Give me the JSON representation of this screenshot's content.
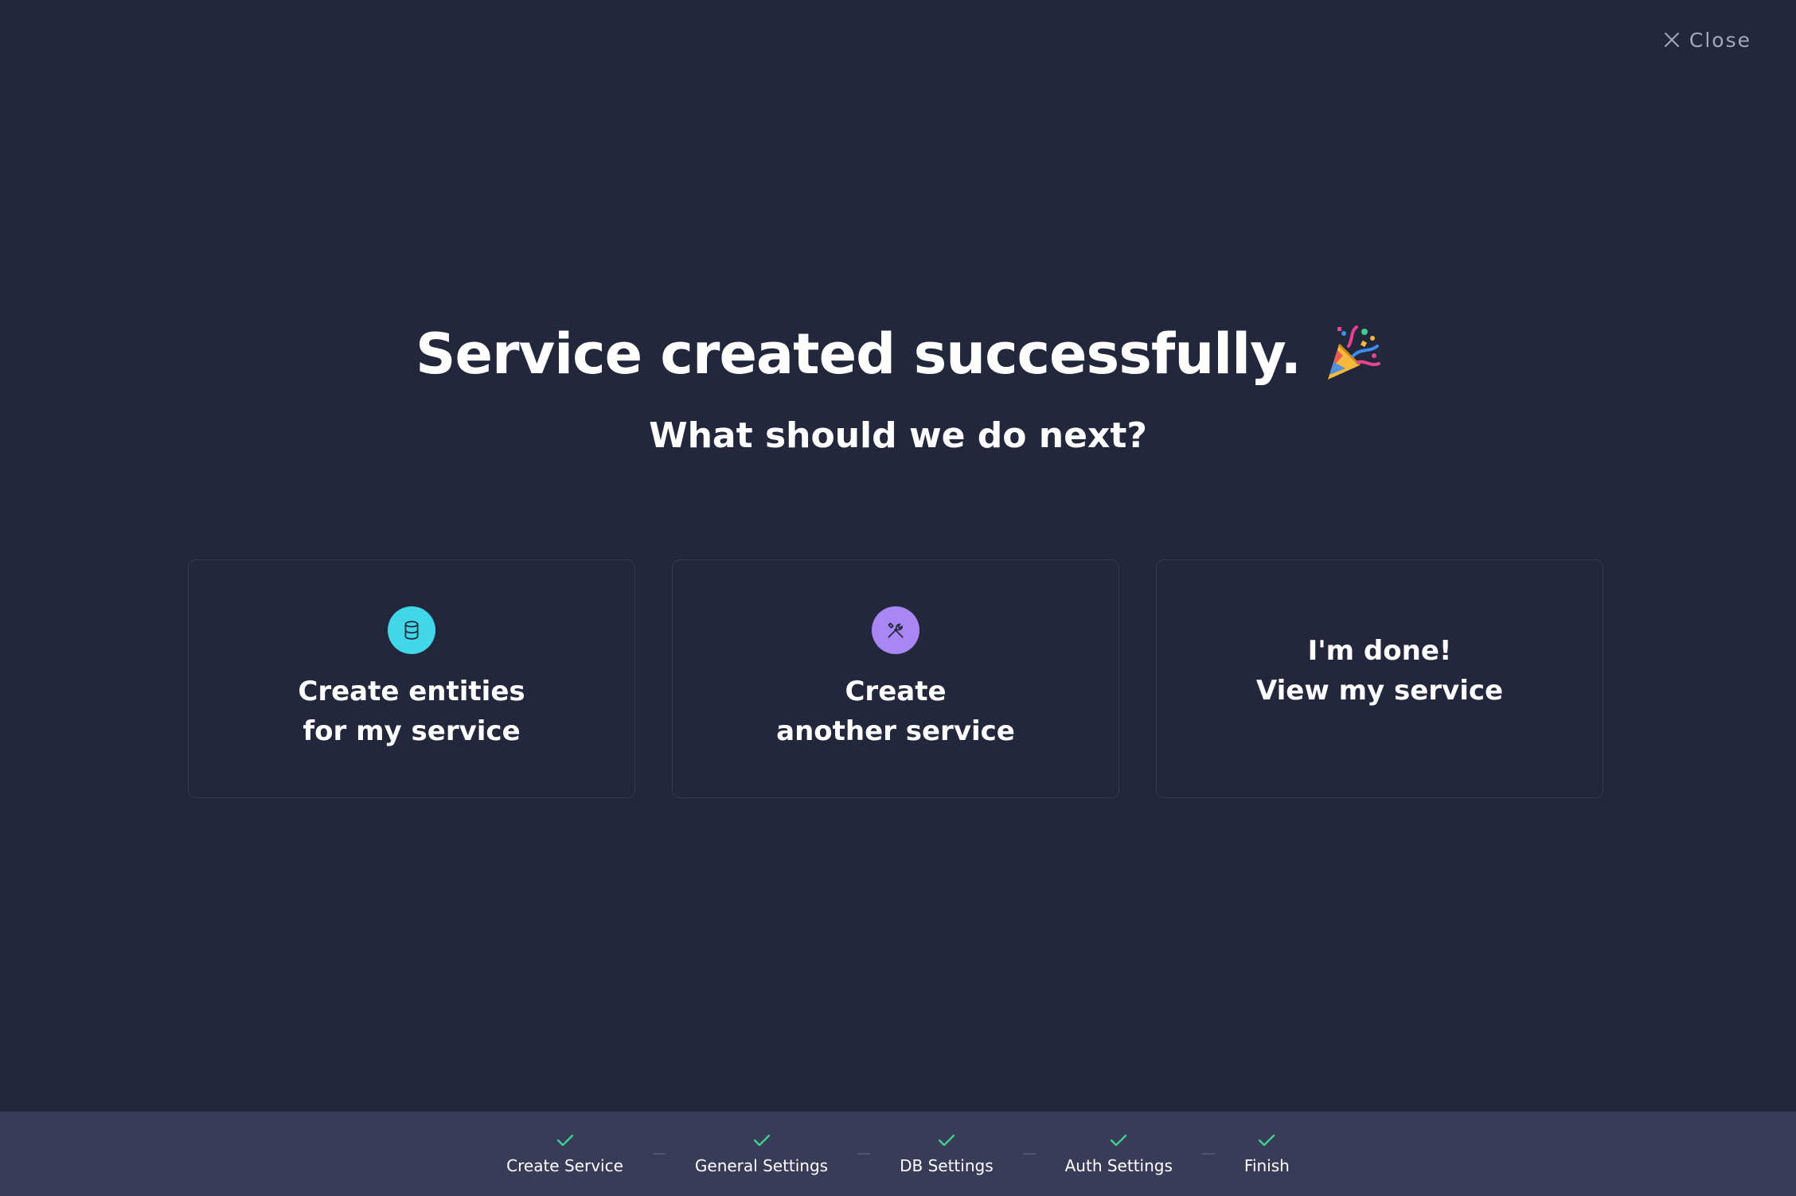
{
  "header": {
    "close_label": "Close",
    "close_icon": "close-icon"
  },
  "main": {
    "title": "Service created successfully.",
    "title_icon": "party-popper-icon",
    "subtitle": "What should we do next?"
  },
  "cards": [
    {
      "icon": "database-icon",
      "icon_color": "#41d6e8",
      "line1": "Create entities",
      "line2": "for my service"
    },
    {
      "icon": "tools-icon",
      "icon_color": "#a887f5",
      "line1": "Create",
      "line2": "another service"
    },
    {
      "line1": "I'm done!",
      "line2": "View my service"
    }
  ],
  "wizard": {
    "check_color": "#3ecf8e",
    "steps": [
      {
        "label": "Create Service",
        "completed": true
      },
      {
        "label": "General Settings",
        "completed": true
      },
      {
        "label": "DB Settings",
        "completed": true
      },
      {
        "label": "Auth Settings",
        "completed": true
      },
      {
        "label": "Finish",
        "completed": true
      }
    ]
  }
}
